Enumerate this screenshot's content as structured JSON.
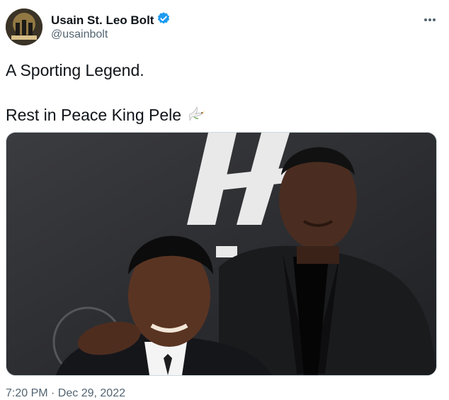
{
  "author": {
    "display_name": "Usain St. Leo Bolt",
    "handle": "@usainbolt",
    "verified": true,
    "verified_color": "#1d9bf0"
  },
  "tweet": {
    "line1": "A Sporting Legend.",
    "line2": "Rest in Peace King Pele",
    "emoji": "dove-icon"
  },
  "media": {
    "alt": "photo"
  },
  "meta": {
    "timestamp": "7:20 PM · Dec 29, 2022"
  },
  "menu": {
    "more_icon": "more-options-icon"
  }
}
